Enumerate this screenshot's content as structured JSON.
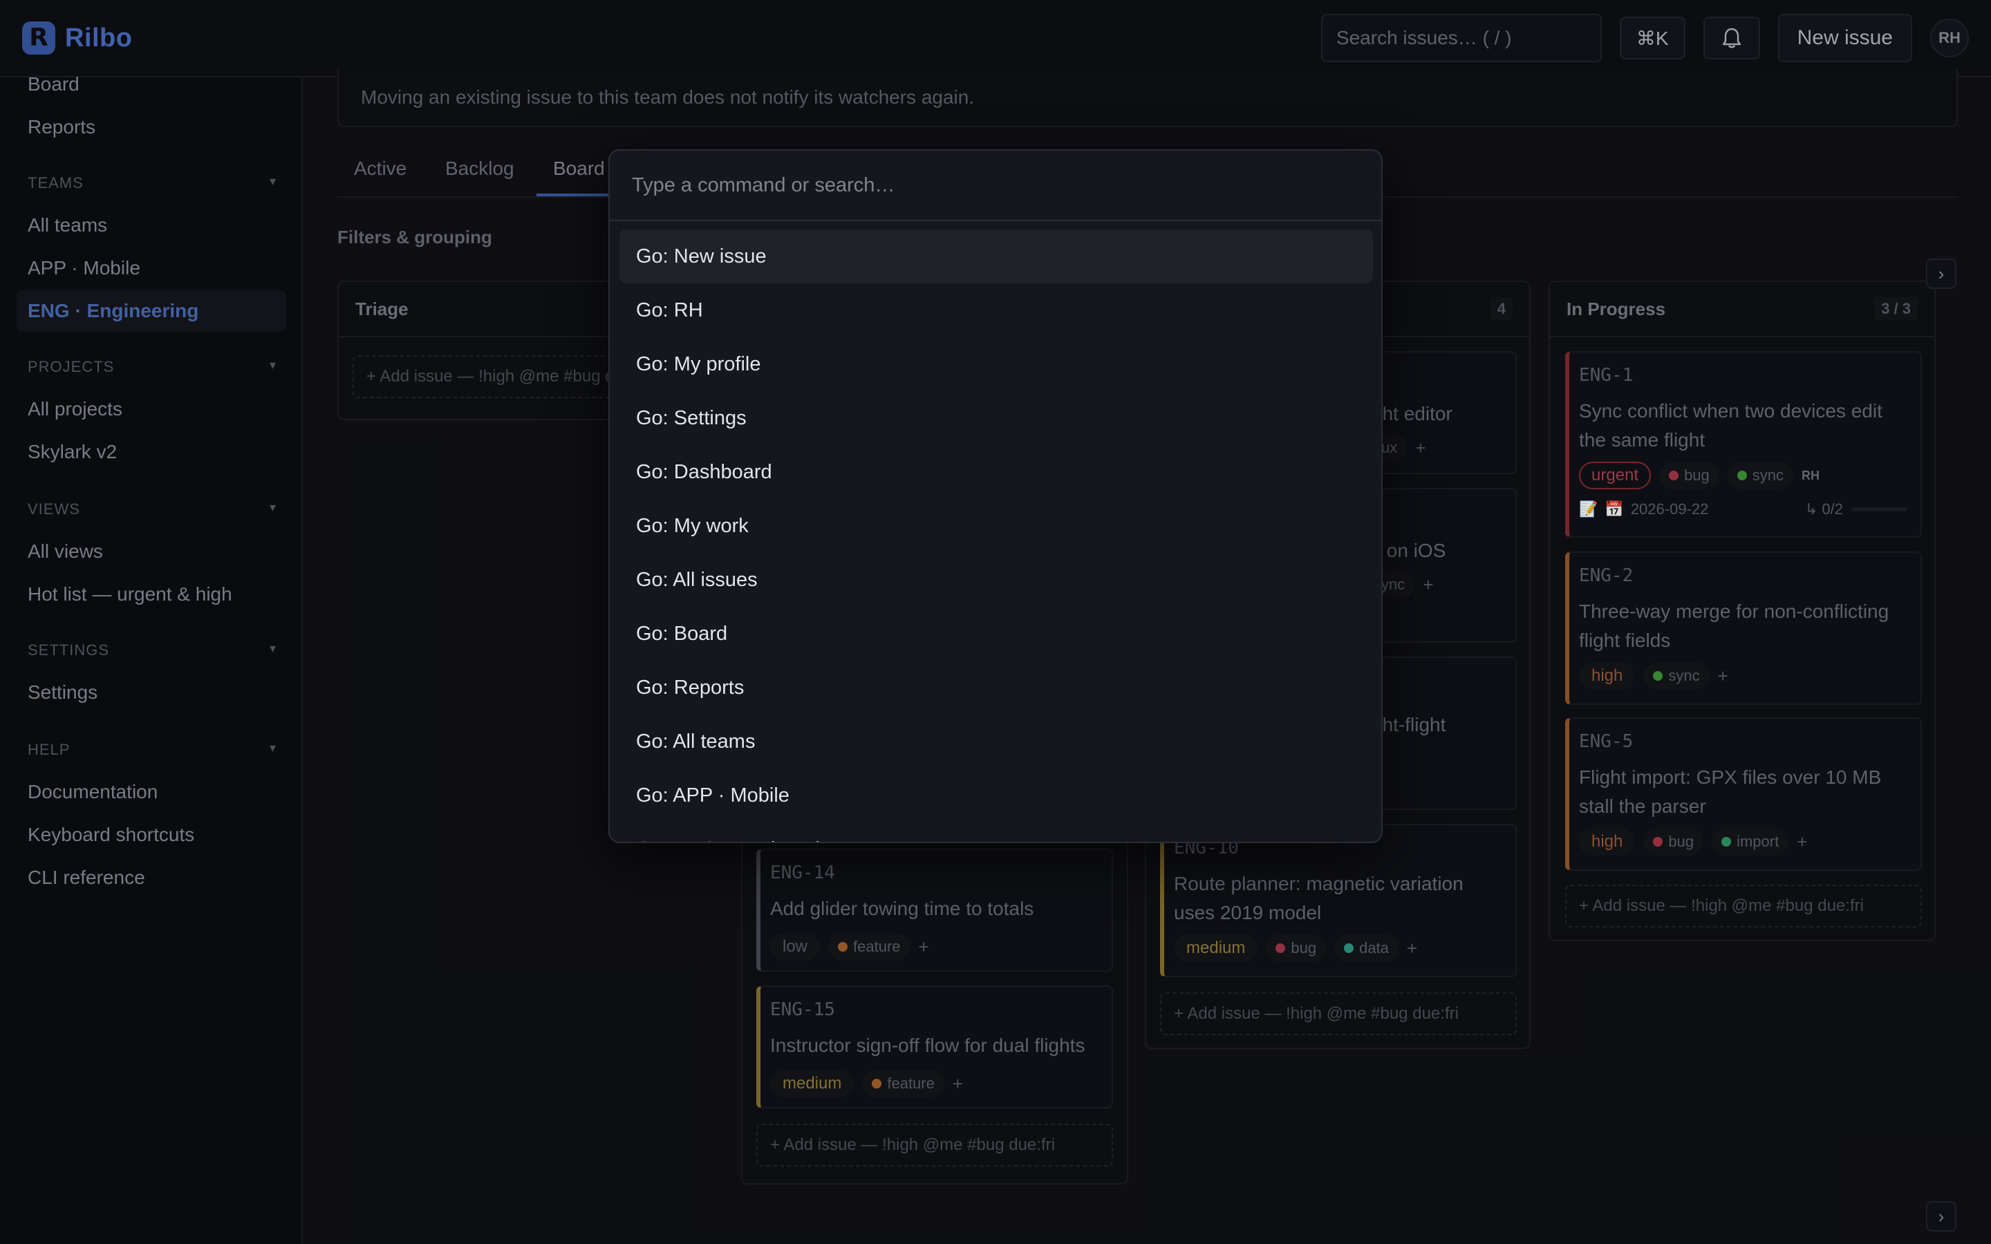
{
  "app": {
    "logo_letter": "R",
    "name": "Rilbo",
    "search_placeholder": "Search issues…  ( / )",
    "shortcut_label": "⌘K",
    "new_issue_label": "New issue",
    "user_initials": "RH"
  },
  "sidebar": {
    "top_items": [
      "Board",
      "Reports"
    ],
    "teams_head": "TEAMS",
    "teams": [
      "All teams",
      "APP · Mobile",
      "ENG · Engineering"
    ],
    "projects_head": "PROJECTS",
    "projects": [
      "All projects",
      "Skylark v2"
    ],
    "views_head": "VIEWS",
    "views": [
      "All views",
      "Hot list — urgent & high"
    ],
    "settings_head": "SETTINGS",
    "settings": [
      "Settings"
    ],
    "help_head": "HELP",
    "help": [
      "Documentation",
      "Keyboard shortcuts",
      "CLI reference"
    ],
    "caret": "▾"
  },
  "main": {
    "banner": "Moving an existing issue to this team does not notify its watchers again.",
    "tabs": [
      "Active",
      "Backlog",
      "Board"
    ],
    "filters_label": "Filters & grouping",
    "add_issue_label": "+ Add issue — !high @me #bug due:fri",
    "columns": {
      "triage": {
        "title": "Triage"
      },
      "middle": {
        "count": "4"
      },
      "in_progress": {
        "title": "In Progress",
        "count": "3 / 3"
      }
    },
    "cards": {
      "col3_a": {
        "title_tail": "ght editor",
        "label_tail": "ux",
        "plus": "+"
      },
      "col3_b": {
        "title_tail": "c on iOS",
        "label_tail": "ync",
        "plus": "+"
      },
      "col3_c": {
        "title_tail": "ght-flight"
      },
      "eng10": {
        "key": "ENG-10",
        "title": "Route planner: magnetic variation uses 2019 model",
        "priority": "medium",
        "labels": [
          "bug",
          "data"
        ],
        "plus": "+"
      },
      "eng14": {
        "key": "ENG-14",
        "title": "Add glider towing time to totals",
        "priority": "low",
        "labels": [
          "feature"
        ],
        "plus": "+"
      },
      "eng15": {
        "key": "ENG-15",
        "title": "Instructor sign-off flow for dual flights",
        "priority": "medium",
        "labels": [
          "feature"
        ],
        "plus": "+"
      },
      "eng1": {
        "key": "ENG-1",
        "title": "Sync conflict when two devices edit the same flight",
        "priority": "urgent",
        "labels": [
          "bug",
          "sync"
        ],
        "assignee": "RH",
        "note_icon": "📝",
        "calendar_icon": "📅",
        "due": "2026-09-22",
        "subtasks": "↳ 0/2"
      },
      "eng2": {
        "key": "ENG-2",
        "title": "Three-way merge for non-conflicting flight fields",
        "priority": "high",
        "labels": [
          "sync"
        ],
        "plus": "+"
      },
      "eng5": {
        "key": "ENG-5",
        "title": "Flight import: GPX files over 10 MB stall the parser",
        "priority": "high",
        "labels": [
          "bug",
          "import"
        ],
        "plus": "+"
      }
    },
    "scroll_glyph": "›"
  },
  "palette": {
    "placeholder": "Type a command or search…",
    "commands": [
      "Go: New issue",
      "Go: RH",
      "Go: My profile",
      "Go: Settings",
      "Go: Dashboard",
      "Go: My work",
      "Go: All issues",
      "Go: Board",
      "Go: Reports",
      "Go: All teams",
      "Go: APP · Mobile",
      "Go: ENG · Engineering"
    ],
    "selected_index": 0
  },
  "colors": {
    "accent": "#4b6fc6",
    "urgent": "#b04450",
    "high": "#a35c34",
    "medium": "#978138",
    "bug_dot": "#a8384a",
    "sync_dot": "#3f9a3a",
    "feature_dot": "#a8632c",
    "data_dot": "#2f9a88",
    "import_dot": "#2f9a66"
  }
}
